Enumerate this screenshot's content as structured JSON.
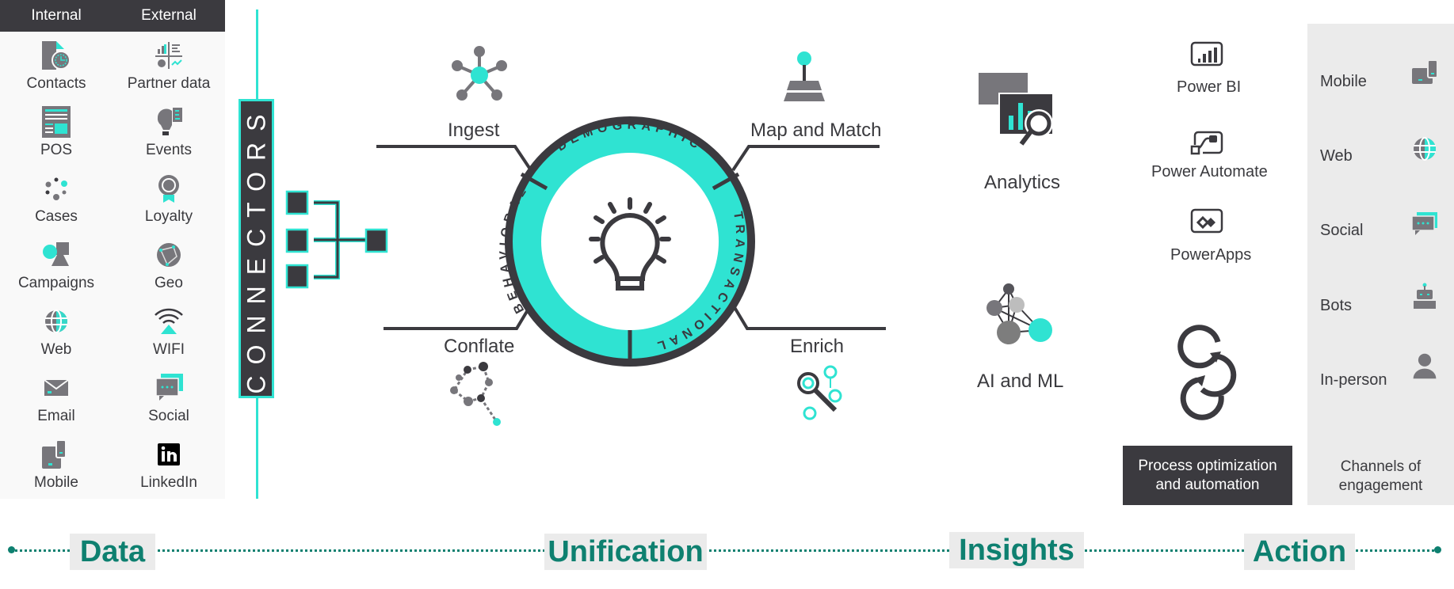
{
  "colors": {
    "teal": "#2fe3d2",
    "dark": "#3b3a3f",
    "gray": "#77767b",
    "green": "#0e8070",
    "panel": "#ebebeb"
  },
  "sources": {
    "header": {
      "internal": "Internal",
      "external": "External"
    },
    "internal": [
      {
        "label": "Contacts",
        "icon": "contacts-icon"
      },
      {
        "label": "POS",
        "icon": "pos-icon"
      },
      {
        "label": "Cases",
        "icon": "cases-icon"
      },
      {
        "label": "Campaigns",
        "icon": "campaigns-icon"
      },
      {
        "label": "Web",
        "icon": "web-globe-icon"
      },
      {
        "label": "Email",
        "icon": "email-icon"
      },
      {
        "label": "Mobile",
        "icon": "mobile-icon"
      }
    ],
    "external": [
      {
        "label": "Partner data",
        "icon": "partner-data-icon"
      },
      {
        "label": "Events",
        "icon": "events-icon"
      },
      {
        "label": "Loyalty",
        "icon": "loyalty-icon"
      },
      {
        "label": "Geo",
        "icon": "geo-icon"
      },
      {
        "label": "WIFI",
        "icon": "wifi-icon"
      },
      {
        "label": "Social",
        "icon": "social-icon"
      },
      {
        "label": "LinkedIn",
        "icon": "linkedin-icon"
      }
    ]
  },
  "connectors": {
    "label": "CONNECTORS"
  },
  "unification": {
    "steps": {
      "ingest": "Ingest",
      "map_match": "Map and Match",
      "conflate": "Conflate",
      "enrich": "Enrich"
    },
    "ring": {
      "top": "DEMOGRAPHIC",
      "left": "BEHAVIORAL",
      "right": "TRANSACTIONAL"
    }
  },
  "insights": {
    "analytics": "Analytics",
    "ai_ml": "AI and ML"
  },
  "action": {
    "tools": [
      "Power BI",
      "Power Automate",
      "PowerApps"
    ],
    "process_box": {
      "line1": "Process optimization",
      "line2": "and automation"
    }
  },
  "channels": {
    "items": [
      "Mobile",
      "Web",
      "Social",
      "Bots",
      "In-person"
    ],
    "caption_line1": "Channels of",
    "caption_line2": "engagement"
  },
  "stages": [
    "Data",
    "Unification",
    "Insights",
    "Action"
  ]
}
